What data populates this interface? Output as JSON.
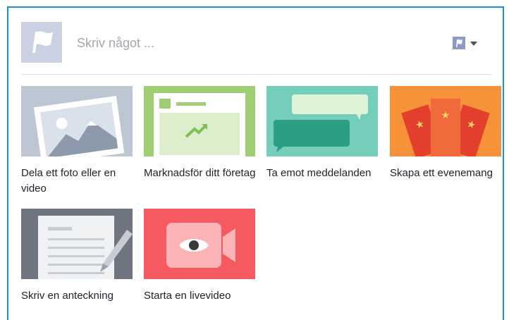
{
  "composer": {
    "placeholder": "Skriv något ..."
  },
  "options": [
    {
      "label": "Dela ett foto eller en video",
      "thumb_color": "#bcc7d3"
    },
    {
      "label": "Marknadsför ditt företag",
      "thumb_color": "#9fce74"
    },
    {
      "label": "Ta emot meddelanden",
      "thumb_color": "#75cdbb"
    },
    {
      "label": "Skapa ett evenemang",
      "thumb_color": "#f7923a"
    },
    {
      "label": "Skriv en anteckning",
      "thumb_color": "#6e7480"
    },
    {
      "label": "Starta en livevideo",
      "thumb_color": "#f55a60"
    }
  ],
  "colors": {
    "focus_border": "#1f8fd6",
    "divider": "#dddfe2",
    "placeholder_text": "#a3a8b1",
    "label_text": "#1d2129"
  },
  "icons": {
    "avatar": "page-flag-icon",
    "audience": "flag-icon",
    "dropdown": "caret-down-icon"
  }
}
